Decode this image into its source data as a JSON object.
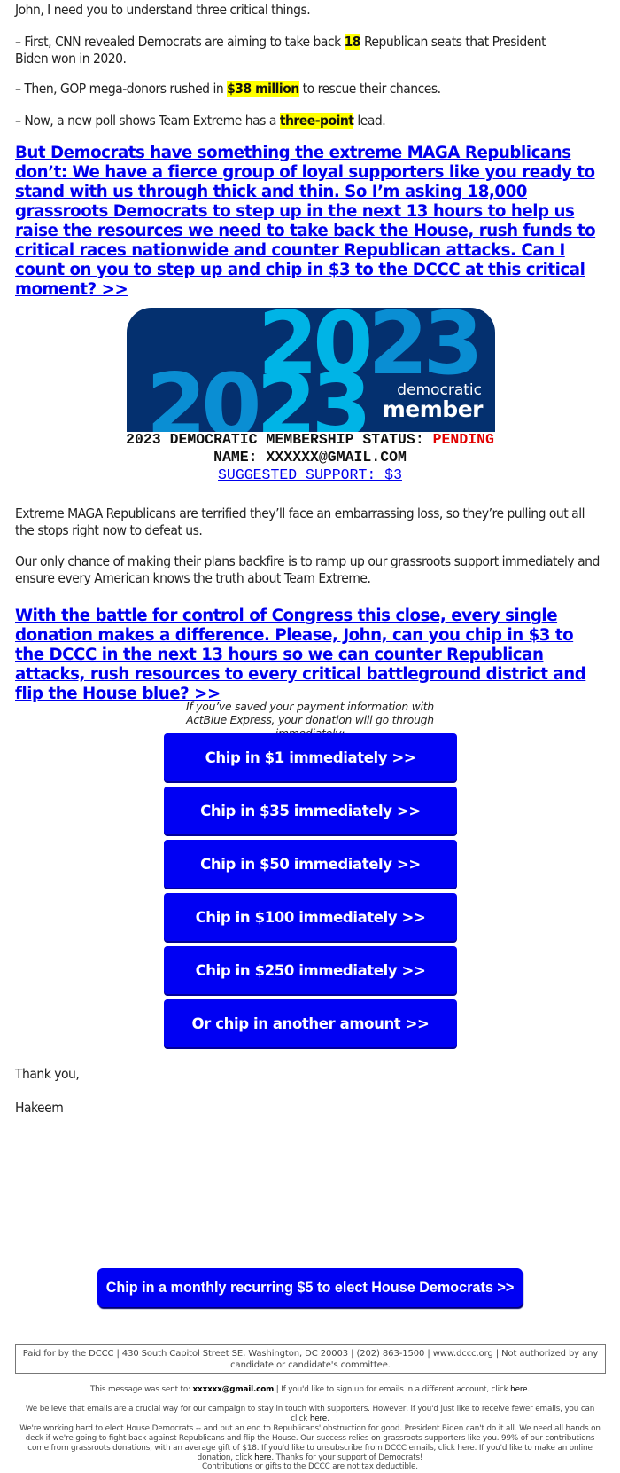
{
  "intro": {
    "greeting": "John, I need you to understand three critical things.",
    "point1_pre": "– First, CNN revealed Democrats are aiming to take back ",
    "point1_hl": "18",
    "point1_post": " Republican seats that President Biden won in 2020.",
    "point2_pre": "– Then, GOP mega-donors rushed in ",
    "point2_hl": "$38 million",
    "point2_post": " to rescue their chances.",
    "point3_pre": "– Now, a new poll shows Team Extreme has a ",
    "point3_hl": "three-point",
    "point3_post": " lead."
  },
  "lead_link_1": "But Democrats have something the extreme MAGA Republicans don’t: We have a fierce group of loyal supporters like you ready to stand with us through thick and thin. So I’m asking 18,000 grassroots Democrats to step up in the next 13 hours to help us raise the resources we need to take back the House, rush funds to critical races nationwide and counter Republican attacks. Can I count on you to step up and chip in $3 to the DCCC at this critical moment? >>",
  "badge": {
    "year_top": "2023",
    "year_bottom": "2023",
    "line1": "democratic",
    "line2": "member",
    "colors": {
      "bg": "#04306f",
      "light": "#00b4e6",
      "mid": "#0a8ed3"
    }
  },
  "membership": {
    "status_label": "2023 DEMOCRATIC MEMBERSHIP STATUS: ",
    "status_value": "PENDING",
    "name_line": "NAME: XXXXXX@GMAIL.COM",
    "suggested": "SUGGESTED SUPPORT: $3"
  },
  "body": {
    "para1": "Extreme MAGA Republicans are terrified they’ll face an embarrassing loss, so they’re pulling out all the stops right now to defeat us.",
    "para2": "Our only chance of making their plans backfire is to ramp up our grassroots support immediately and ensure every American knows the truth about Team Extreme."
  },
  "lead_link_2": "With the battle for control of Congress this close, every single donation makes a difference. Please, John, can you chip in $3 to the DCCC in the next 13 hours so we can counter Republican attacks, rush resources to every critical battleground district and flip the House blue? >>",
  "express_note": "If you’ve saved your payment information with ActBlue Express, your donation will go through immediately:",
  "donate_buttons": [
    {
      "label": "Chip in $1 immediately >>"
    },
    {
      "label": "Chip in $35 immediately >>"
    },
    {
      "label": "Chip in $50 immediately >>"
    },
    {
      "label": "Chip in $100 immediately >>"
    },
    {
      "label": "Chip in $250 immediately >>"
    },
    {
      "label": "Or chip in another amount >>"
    }
  ],
  "signoff": {
    "thanks": "Thank you,",
    "name": "Hakeem"
  },
  "monthly_button": "Chip in a monthly recurring $5 to elect House Democrats >>",
  "paid_for": "Paid for by the DCCC | 430 South Capitol Street SE, Washington, DC 20003 | (202) 863-1500 | www.dccc.org | Not authorized by any candidate or candidate's committee.",
  "footer": {
    "sent_pre": "This message was sent to: ",
    "sent_email": "xxxxxx@gmail.com",
    "sent_post": " | If you'd like to sign up for emails in a different account, click ",
    "here": "here",
    "fewer_pre": "We believe that emails are a crucial way for our campaign to stay in touch with supporters. However, if you'd just like to receive fewer emails, you can click ",
    "work_pre": "We're working hard to elect House Democrats -- and put an end to Republicans' obstruction for good. President Biden can't do it all. We need all hands on deck if we're going to fight back against Republicans and flip the House. Our success relies on grassroots supporters like you. 99% of our contributions come from grassroots donations, with an average gift of $18. If you'd like to unsubscribe from DCCC emails, click here. If you'd like to make an online donation, click ",
    "work_post": ". Thanks for your support of Democrats!",
    "tax": "Contributions or gifts to the DCCC are not tax deductible."
  }
}
